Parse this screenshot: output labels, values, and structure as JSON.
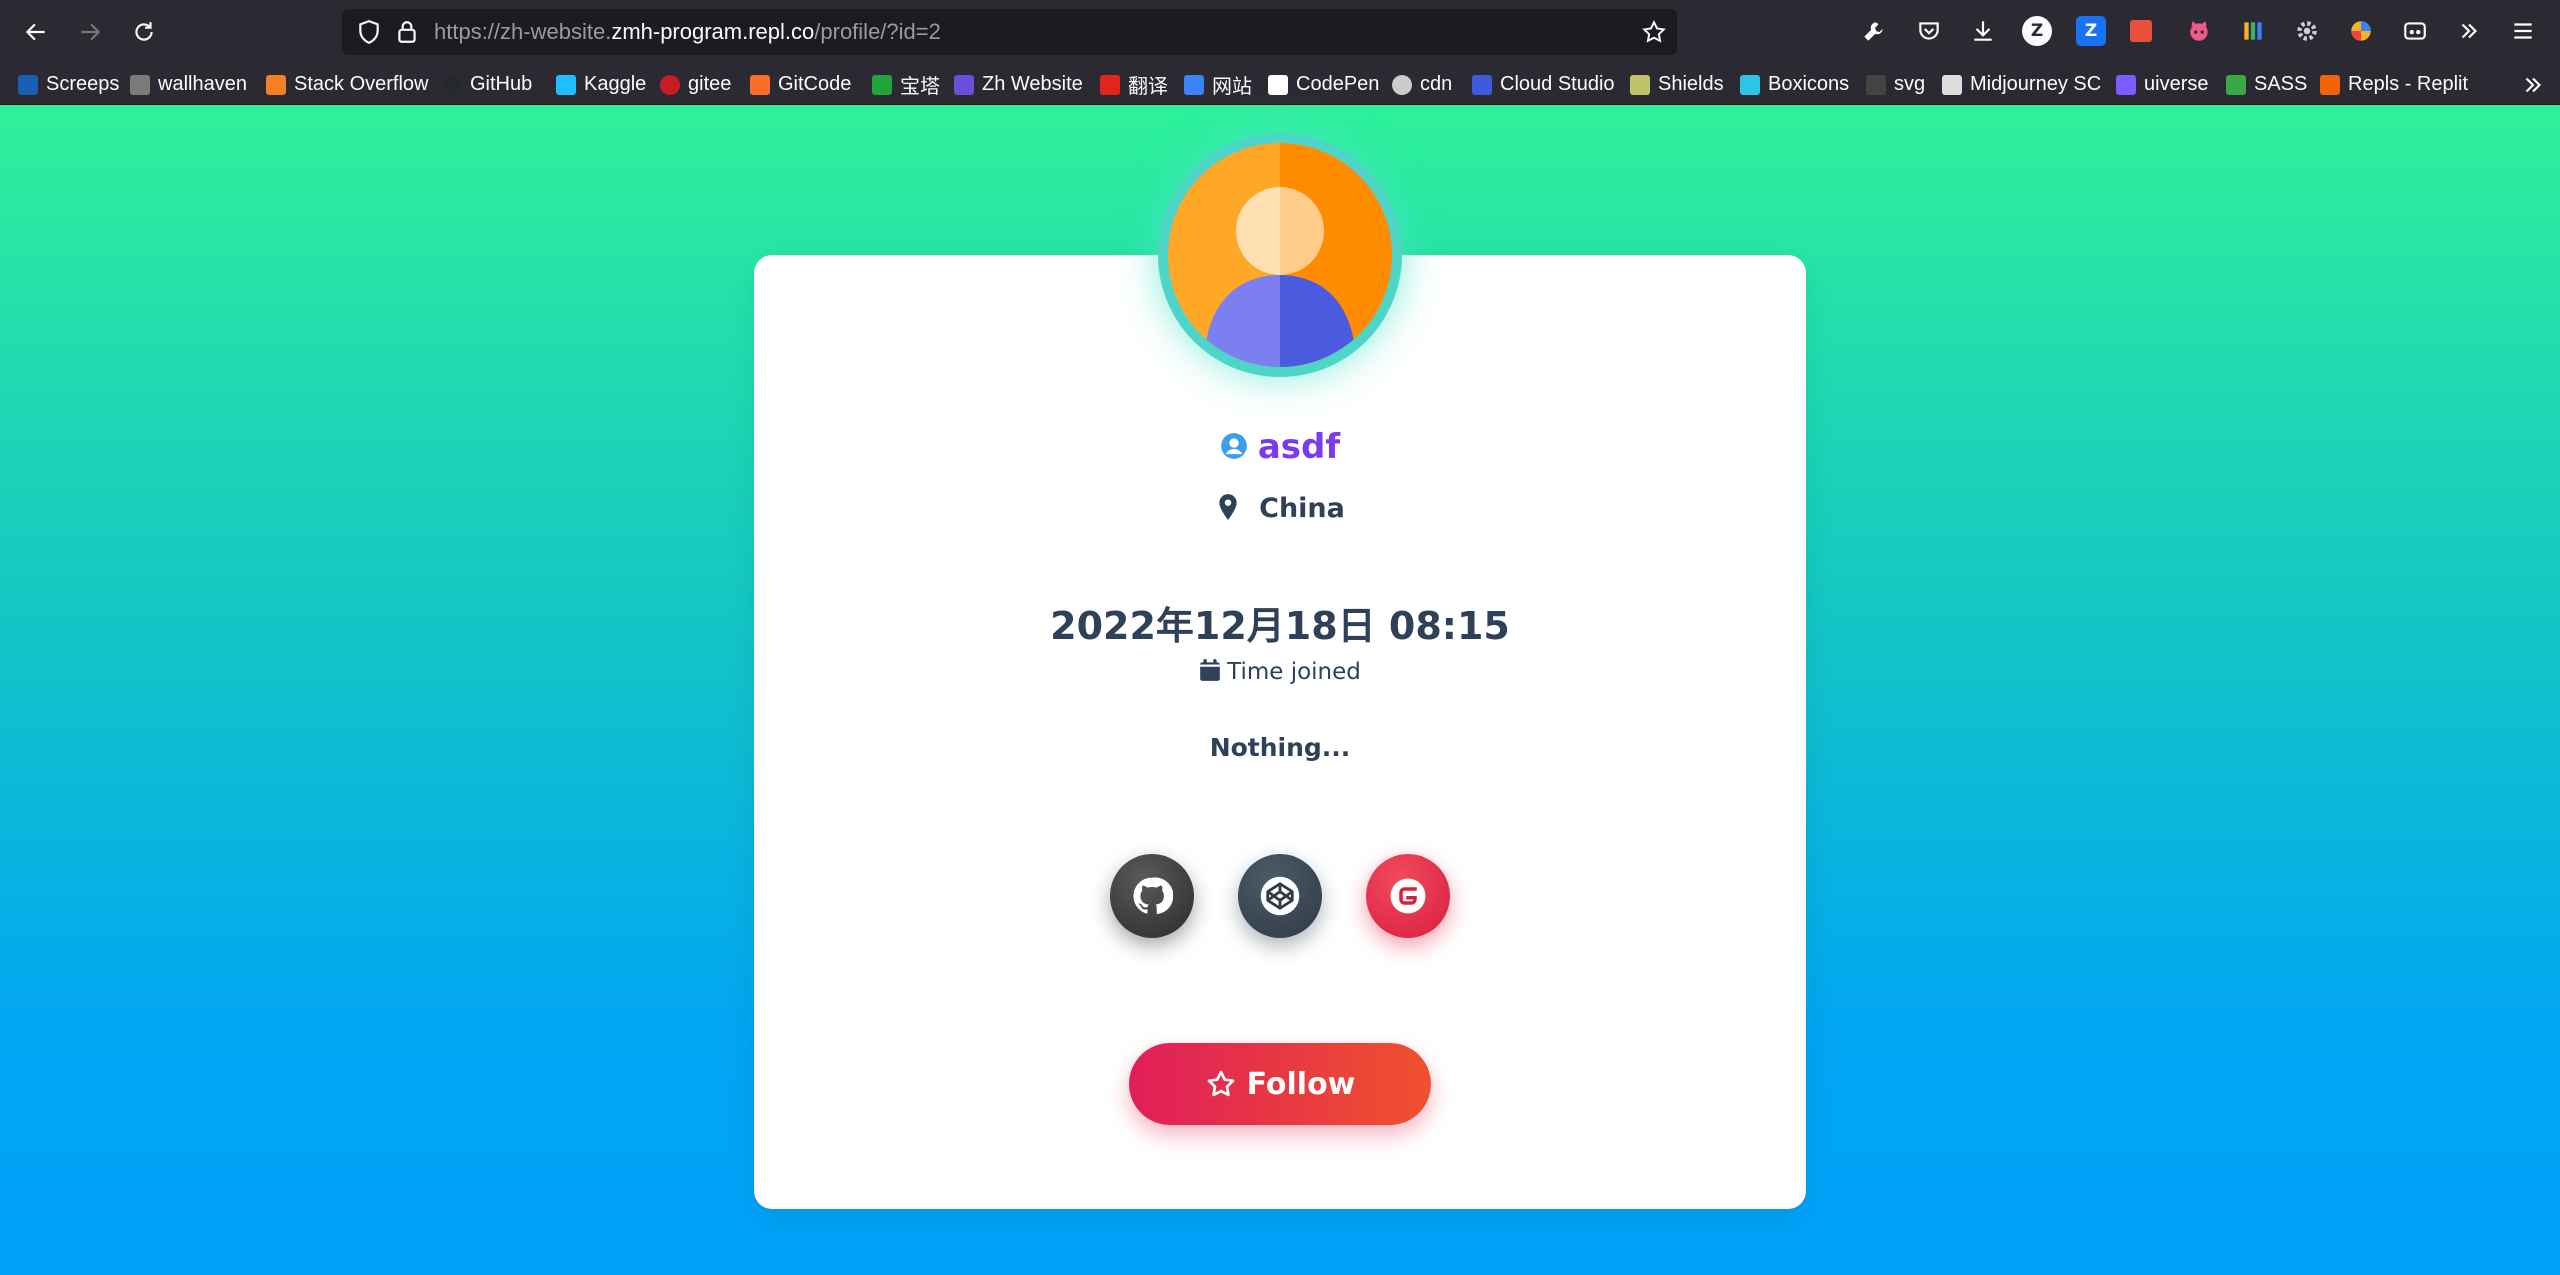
{
  "browser": {
    "url_prefix": "https://zh-website.",
    "url_host": "zmh-program.repl.co",
    "url_path": "/profile/?id=2"
  },
  "toolbar_icons": [
    {
      "name": "wrench-icon"
    },
    {
      "name": "pocket-icon"
    },
    {
      "name": "download-icon"
    },
    {
      "name": "zotero-icon",
      "glyph": "Z"
    },
    {
      "name": "zhihu-extension-icon",
      "glyph": "Z"
    },
    {
      "name": "translate-extension-icon"
    },
    {
      "name": "octocat-extension-icon"
    },
    {
      "name": "library-icon"
    },
    {
      "name": "settings-extension-icon"
    },
    {
      "name": "color-extension-icon"
    },
    {
      "name": "reader-extension-icon"
    },
    {
      "name": "more-tools-icon"
    },
    {
      "name": "menu-icon"
    }
  ],
  "bookmarks": [
    {
      "label": "Screeps",
      "color": "#1a5fb4"
    },
    {
      "label": "wallhaven",
      "color": "#7a7a7a"
    },
    {
      "label": "Stack Overflow",
      "color": "#f48024"
    },
    {
      "label": "GitHub",
      "color": "#24292e"
    },
    {
      "label": "Kaggle",
      "color": "#20beff"
    },
    {
      "label": "gitee",
      "color": "#c71d23"
    },
    {
      "label": "GitCode",
      "color": "#fc6d26"
    },
    {
      "label": "宝塔",
      "color": "#20a53a"
    },
    {
      "label": "Zh Website",
      "color": "#6c4fd8"
    },
    {
      "label": "翻译",
      "color": "#e1251b"
    },
    {
      "label": "网站",
      "color": "#3b82f6"
    },
    {
      "label": "CodePen",
      "color": "#ffffff"
    },
    {
      "label": "cdn",
      "color": "#cccccc"
    },
    {
      "label": "Cloud Studio",
      "color": "#3b5bdb"
    },
    {
      "label": "Shields",
      "color": "#c2c26a"
    },
    {
      "label": "Boxicons",
      "color": "#2ec4e6"
    },
    {
      "label": "svg",
      "color": "#444444"
    },
    {
      "label": "Midjourney SC",
      "color": "#dddddd"
    },
    {
      "label": "uiverse",
      "color": "#7c5cff"
    },
    {
      "label": "SASS",
      "color": "#3aa845"
    },
    {
      "label": "Repls - Replit",
      "color": "#f26207"
    }
  ],
  "profile": {
    "username": "asdf",
    "location": "China",
    "joined_date": "2022年12月18日 08:15",
    "joined_label": "Time joined",
    "bio": "Nothing...",
    "follow_label": "Follow",
    "socials": [
      "github-link",
      "codepen-link",
      "gitee-link"
    ]
  },
  "colors": {
    "username": "#7c3aed",
    "text": "#2e4158",
    "follow_start": "#e01e5a",
    "follow_end": "#f0512d",
    "bg_top": "#2ef19a",
    "bg_bottom": "#00a1fb"
  }
}
